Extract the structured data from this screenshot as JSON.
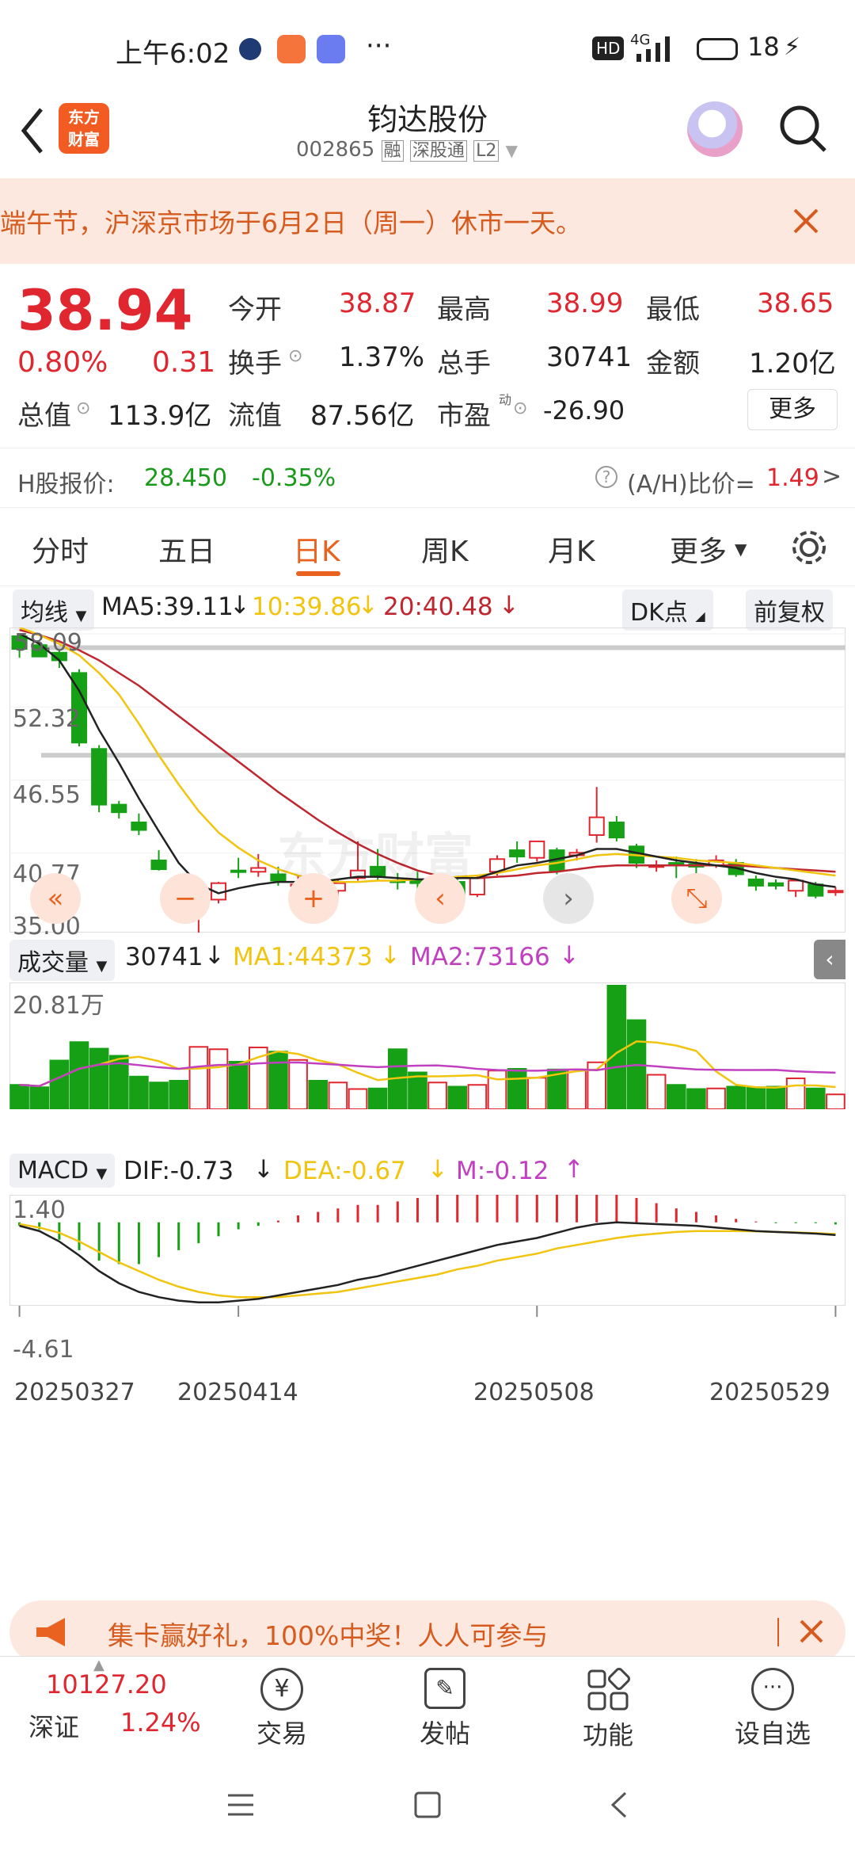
{
  "status_bar": {
    "time": "上午6:02",
    "dots": "···",
    "hd": "HD",
    "net": "4G",
    "battery": "18"
  },
  "header": {
    "logo_line1": "东方",
    "logo_line2": "财富",
    "title": "钧达股份",
    "code": "002865",
    "tags": [
      "融",
      "深股通",
      "L2"
    ]
  },
  "notice": {
    "text": "端午节，沪深京市场于6月2日（周一）休市一天。"
  },
  "quote": {
    "price": "38.94",
    "change_pct": "0.80%",
    "change": "0.31",
    "stats": [
      {
        "label": "今开",
        "value": "38.87",
        "color": "red"
      },
      {
        "label": "最高",
        "value": "38.99",
        "color": "red"
      },
      {
        "label": "最低",
        "value": "38.65",
        "color": "red"
      },
      {
        "label": "换手",
        "value": "1.37%",
        "color": "dark"
      },
      {
        "label": "总手",
        "value": "30741",
        "color": "dark"
      },
      {
        "label": "金额",
        "value": "1.20亿",
        "color": "dark"
      }
    ],
    "total_value_label": "总值",
    "total_value": "113.9亿",
    "float_value_label": "流值",
    "float_value": "87.56亿",
    "pe_label": "市盈",
    "pe_sup": "动",
    "pe_value": "-26.90",
    "more": "更多"
  },
  "h_share": {
    "label": "H股报价:",
    "price": "28.450",
    "pct": "-0.35%",
    "ah_label": "(A/H)比价=",
    "ah_value": "1.49"
  },
  "tabs": [
    "分时",
    "五日",
    "日K",
    "周K",
    "月K",
    "更多"
  ],
  "active_tab": "日K",
  "ma_legend": {
    "selector": "均线",
    "ma5": "MA5:39.11",
    "ma10": "10:39.86",
    "ma20": "20:40.48",
    "dk": "DK点",
    "adjust": "前复权"
  },
  "price_axis": [
    "58.09",
    "52.32",
    "46.55",
    "40.77",
    "35.00"
  ],
  "vol_legend": {
    "selector": "成交量",
    "vol": "30741",
    "ma1": "MA1:44373",
    "ma2": "MA2:73166",
    "axis": "20.81万"
  },
  "macd_legend": {
    "selector": "MACD",
    "dif": "DIF:-0.73",
    "dea": "DEA:-0.67",
    "m": "M:-0.12",
    "top": "1.40",
    "bottom": "-4.61"
  },
  "dates": [
    "20250327",
    "20250414",
    "20250508",
    "20250529"
  ],
  "watermark": "东方财富",
  "banner": {
    "text": "集卡赢好礼，100%中奖！人人可参与"
  },
  "bottom_nav": {
    "index_value": "10127.20",
    "index_name": "深证",
    "index_pct": "1.24%",
    "items": [
      "交易",
      "发帖",
      "功能",
      "设自选"
    ]
  },
  "chart_data": {
    "type": "candlestick",
    "ylim": [
      35.0,
      58.09
    ],
    "candles": [
      [
        57.9,
        58.1,
        56.9,
        56.2
      ],
      [
        57.2,
        57.5,
        56.3,
        56.5
      ],
      [
        56.6,
        56.8,
        56.0,
        55.4
      ],
      [
        55.0,
        55.3,
        49.5,
        49.2
      ],
      [
        49.0,
        49.3,
        44.6,
        44.0
      ],
      [
        44.6,
        44.9,
        44.0,
        43.5
      ],
      [
        43.2,
        43.9,
        42.6,
        42.2
      ],
      [
        40.2,
        41.0,
        39.5,
        39.4
      ],
      [
        37.8,
        38.4,
        36.6,
        36.0
      ],
      [
        36.2,
        37.6,
        37.1,
        34.5
      ],
      [
        37.1,
        38.5,
        38.4,
        36.8
      ],
      [
        39.4,
        40.4,
        39.3,
        38.8
      ],
      [
        39.3,
        40.7,
        39.6,
        38.9
      ],
      [
        39.1,
        39.7,
        38.6,
        38.2
      ],
      [
        38.3,
        39.0,
        38.3,
        37.8
      ],
      [
        38.2,
        38.8,
        37.7,
        37.4
      ],
      [
        37.8,
        38.7,
        38.4,
        37.4
      ],
      [
        38.8,
        41.7,
        39.4,
        38.6
      ],
      [
        39.7,
        41.1,
        39.0,
        38.6
      ],
      [
        38.6,
        39.2,
        38.5,
        37.9
      ],
      [
        38.6,
        39.3,
        38.4,
        37.9
      ],
      [
        38.2,
        39.1,
        38.5,
        37.9
      ],
      [
        38.5,
        38.8,
        37.5,
        37.2
      ],
      [
        37.5,
        39.0,
        38.8,
        37.3
      ],
      [
        39.3,
        40.6,
        40.3,
        39.0
      ],
      [
        41.0,
        41.7,
        40.5,
        40.0
      ],
      [
        40.4,
        41.6,
        41.7,
        40.1
      ],
      [
        41.0,
        41.2,
        39.4,
        39.1
      ],
      [
        40.6,
        41.1,
        40.8,
        40.2
      ],
      [
        42.2,
        46.0,
        43.6,
        41.6
      ],
      [
        43.2,
        43.7,
        42.0,
        41.7
      ],
      [
        41.3,
        41.5,
        40.0,
        39.6
      ],
      [
        39.7,
        40.2,
        39.8,
        39.3
      ],
      [
        40.0,
        40.5,
        39.8,
        38.8
      ],
      [
        39.9,
        40.3,
        39.7,
        38.9
      ],
      [
        39.8,
        40.6,
        40.2,
        39.6
      ],
      [
        40.0,
        40.3,
        39.1,
        38.9
      ],
      [
        38.7,
        39.0,
        38.2,
        37.8
      ],
      [
        38.4,
        38.7,
        38.2,
        37.9
      ],
      [
        37.8,
        38.6,
        38.6,
        37.3
      ],
      [
        38.3,
        38.5,
        37.4,
        37.2
      ],
      [
        37.8,
        38.1,
        37.8,
        37.4
      ]
    ],
    "ma5": [
      58.1,
      57.3,
      56.0,
      53.6,
      50.5,
      47.9,
      45.1,
      42.5,
      40.0,
      38.3,
      37.6,
      38.0,
      38.3,
      38.5,
      38.5,
      38.5,
      38.7,
      38.9,
      38.9,
      38.8,
      38.7,
      38.7,
      38.8,
      38.8,
      39.3,
      39.8,
      40.0,
      40.3,
      40.6,
      41.1,
      41.1,
      40.8,
      40.5,
      40.2,
      40.0,
      39.8,
      39.6,
      39.2,
      38.9,
      38.7,
      38.3,
      38.1
    ],
    "ma10": [
      58.6,
      58.0,
      57.3,
      56.4,
      55.0,
      53.3,
      51.0,
      48.5,
      46.2,
      44.1,
      42.4,
      41.2,
      40.2,
      39.5,
      39.0,
      38.7,
      38.5,
      38.5,
      38.6,
      38.6,
      38.7,
      38.7,
      38.9,
      39.0,
      39.2,
      39.5,
      39.8,
      40.0,
      40.3,
      40.6,
      40.7,
      40.6,
      40.5,
      40.4,
      40.2,
      40.1,
      40.0,
      39.8,
      39.6,
      39.4,
      39.2,
      39.0
    ],
    "ma20": [
      58.4,
      58.0,
      57.5,
      56.8,
      56.0,
      55.0,
      54.0,
      52.8,
      51.6,
      50.4,
      49.2,
      48.0,
      46.8,
      45.6,
      44.5,
      43.4,
      42.4,
      41.5,
      40.7,
      40.0,
      39.4,
      39.0,
      38.8,
      38.8,
      38.9,
      39.0,
      39.2,
      39.3,
      39.5,
      39.7,
      39.8,
      39.8,
      39.8,
      39.8,
      39.8,
      39.8,
      39.8,
      39.7,
      39.6,
      39.5,
      39.4,
      39.3
    ],
    "volume": [
      4.1,
      3.7,
      8.2,
      11.3,
      10.2,
      9.0,
      5.5,
      4.5,
      4.8,
      10.5,
      10.1,
      8.0,
      10.4,
      9.7,
      8.3,
      4.8,
      4.5,
      3.4,
      3.5,
      10.1,
      6.2,
      4.5,
      3.8,
      4.1,
      6.5,
      6.8,
      5.3,
      6.7,
      6.7,
      7.9,
      20.81,
      15.0,
      5.8,
      4.1,
      3.4,
      3.5,
      3.8,
      3.7,
      3.8,
      5.2,
      3.5,
      2.5
    ],
    "macd_dif": [
      -0.2,
      -0.5,
      -1.1,
      -1.9,
      -2.8,
      -3.5,
      -4.0,
      -4.3,
      -4.5,
      -4.6,
      -4.6,
      -4.5,
      -4.4,
      -4.2,
      -4.0,
      -3.8,
      -3.6,
      -3.3,
      -3.1,
      -2.8,
      -2.5,
      -2.2,
      -1.9,
      -1.6,
      -1.3,
      -1.1,
      -0.9,
      -0.6,
      -0.3,
      -0.1,
      0.0,
      -0.05,
      -0.1,
      -0.15,
      -0.2,
      -0.3,
      -0.4,
      -0.5,
      -0.55,
      -0.6,
      -0.65,
      -0.73
    ],
    "macd_dea": [
      -0.1,
      -0.3,
      -0.6,
      -1.1,
      -1.7,
      -2.3,
      -2.8,
      -3.3,
      -3.7,
      -4.0,
      -4.2,
      -4.3,
      -4.3,
      -4.3,
      -4.2,
      -4.1,
      -4.0,
      -3.8,
      -3.6,
      -3.4,
      -3.2,
      -3.0,
      -2.7,
      -2.5,
      -2.2,
      -2.0,
      -1.8,
      -1.5,
      -1.3,
      -1.1,
      -0.9,
      -0.75,
      -0.65,
      -0.55,
      -0.5,
      -0.5,
      -0.5,
      -0.52,
      -0.55,
      -0.58,
      -0.62,
      -0.67
    ],
    "macd_m": [
      -0.2,
      -0.4,
      -1.0,
      -1.6,
      -2.2,
      -2.4,
      -2.4,
      -2.0,
      -1.6,
      -1.2,
      -0.8,
      -0.4,
      -0.2,
      0.1,
      0.4,
      0.6,
      0.8,
      1.0,
      1.0,
      1.2,
      1.4,
      1.6,
      1.6,
      1.8,
      1.8,
      1.8,
      1.8,
      1.8,
      2.0,
      2.0,
      1.8,
      1.4,
      1.1,
      0.8,
      0.6,
      0.4,
      0.2,
      0.05,
      -0.05,
      -0.05,
      -0.05,
      -0.12
    ]
  }
}
